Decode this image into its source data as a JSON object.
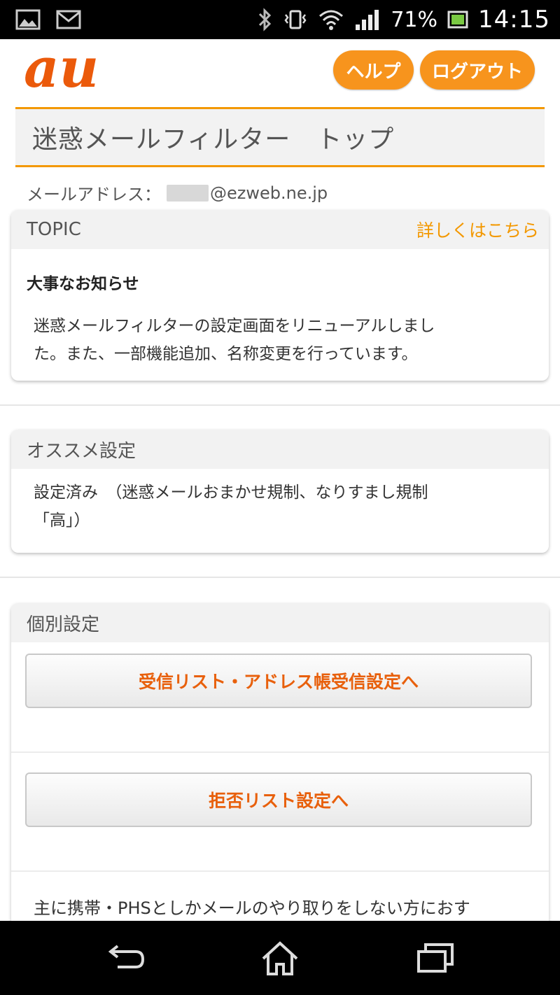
{
  "status_bar": {
    "battery_percent": "71%",
    "time": "14:15",
    "icons": [
      "image-icon",
      "mail-icon",
      "bluetooth-icon",
      "vibrate-icon",
      "wifi-icon",
      "signal-icon",
      "battery-icon"
    ]
  },
  "header": {
    "logo_text": "au",
    "help_label": "ヘルプ",
    "logout_label": "ログアウト",
    "brand_color": "#f39800"
  },
  "page": {
    "title": "迷惑メールフィルター　トップ",
    "mail_label": "メールアドレス：",
    "mail_domain": "@ezweb.ne.jp"
  },
  "topic": {
    "header": "TOPIC",
    "link": "詳しくはこちら",
    "news_title": "大事なお知らせ",
    "news_line1": "迷惑メールフィルターの設定画面をリニューアルしまし",
    "news_line2": "た。また、一部機能追加、名称変更を行っています。"
  },
  "recommended": {
    "header": "オススメ設定",
    "line1": "設定済み　（迷惑メールおまかせ規制、なりすまし規制",
    "line2": "「高」）"
  },
  "individual": {
    "header": "個別設定",
    "button1": "受信リスト・アドレス帳受信設定へ",
    "button2": "拒否リスト設定へ",
    "note": "主に携帯・PHSとしかメールのやり取りをしない方におす"
  },
  "nav": {
    "icons": [
      "back-icon",
      "home-icon",
      "recent-apps-icon"
    ]
  }
}
